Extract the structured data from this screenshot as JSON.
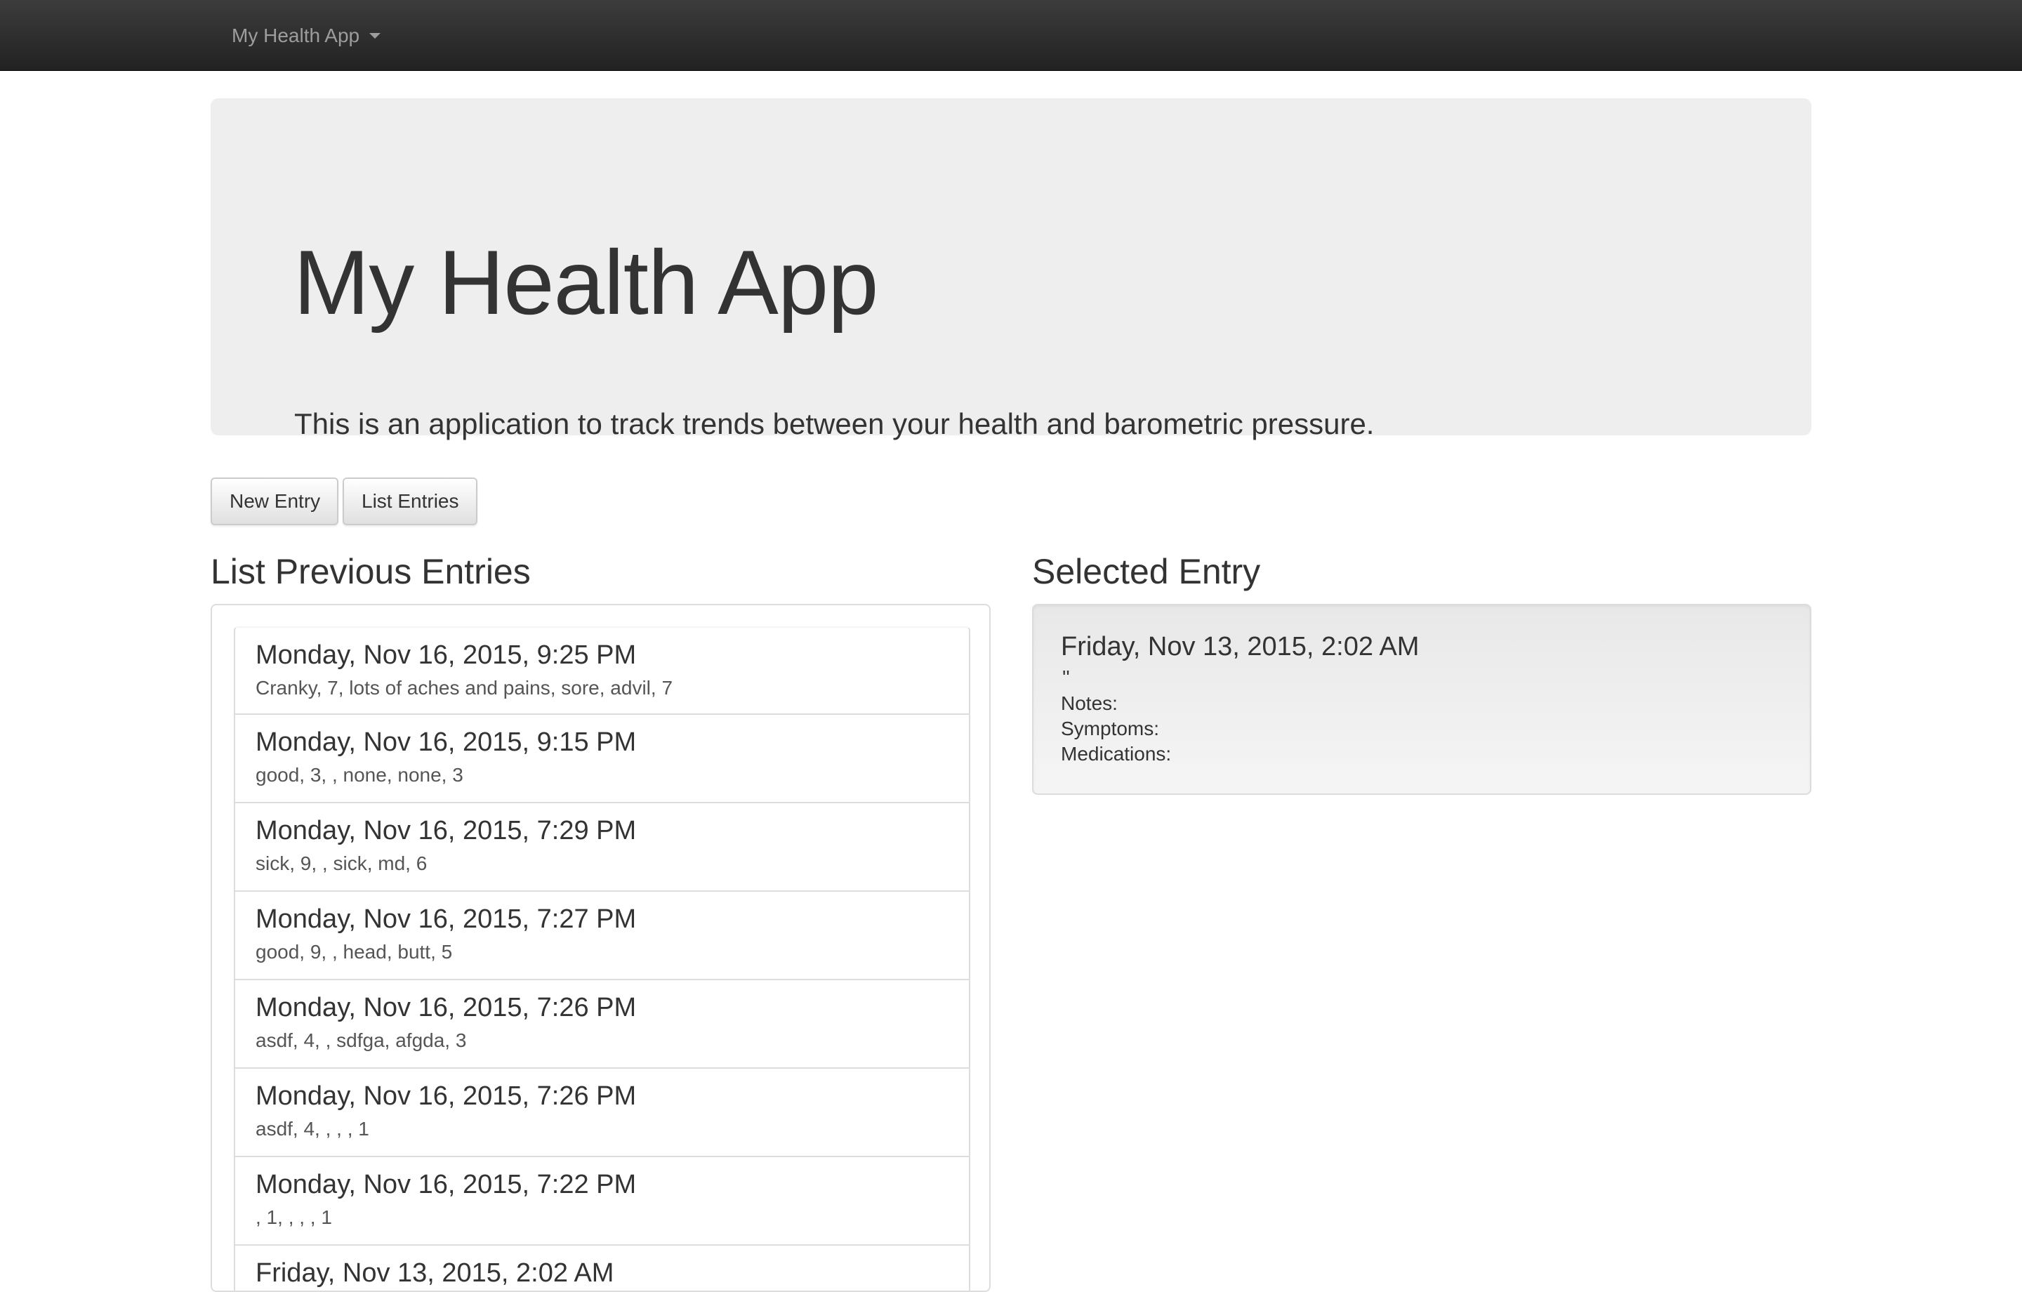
{
  "navbar": {
    "brand": "My Health App"
  },
  "jumbotron": {
    "title": "My Health App",
    "lead": "This is an application to track trends between your health and barometric pressure."
  },
  "buttons": {
    "new_entry": "New Entry",
    "list_entries": "List Entries"
  },
  "list_section": {
    "title": "List Previous Entries",
    "entries": [
      {
        "heading": "Monday, Nov 16, 2015, 9:25 PM",
        "text": "Cranky, 7, lots of aches and pains, sore, advil, 7"
      },
      {
        "heading": "Monday, Nov 16, 2015, 9:15 PM",
        "text": "good, 3, , none, none, 3"
      },
      {
        "heading": "Monday, Nov 16, 2015, 7:29 PM",
        "text": "sick, 9, , sick, md, 6"
      },
      {
        "heading": "Monday, Nov 16, 2015, 7:27 PM",
        "text": "good, 9, , head, butt, 5"
      },
      {
        "heading": "Monday, Nov 16, 2015, 7:26 PM",
        "text": "asdf, 4, , sdfga, afgda, 3"
      },
      {
        "heading": "Monday, Nov 16, 2015, 7:26 PM",
        "text": "asdf, 4, , , , 1"
      },
      {
        "heading": "Monday, Nov 16, 2015, 7:22 PM",
        "text": ", 1, , , , 1"
      },
      {
        "heading": "Friday, Nov 13, 2015, 2:02 AM",
        "text": ""
      }
    ]
  },
  "selected_section": {
    "title": "Selected Entry",
    "heading": "Friday, Nov 13, 2015, 2:02 AM",
    "quote": "''",
    "notes_label": "Notes:",
    "symptoms_label": "Symptoms:",
    "medications_label": "Medications:"
  }
}
